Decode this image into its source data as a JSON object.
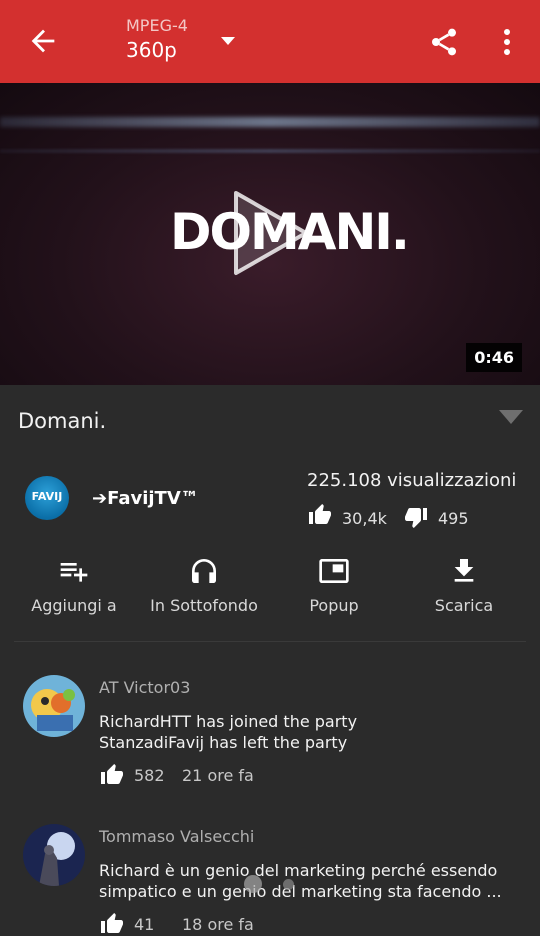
{
  "topbar": {
    "format": "MPEG-4",
    "resolution": "360p",
    "colors": {
      "bar": "#d3302f"
    }
  },
  "video": {
    "overlay_text": "DOMANI.",
    "duration": "0:46"
  },
  "details": {
    "title": "Domani.",
    "channel": "➔FavijTV™",
    "channel_avatar_text": "FAVIJ",
    "views": "225.108 visualizzazioni",
    "likes": "30,4k",
    "dislikes": "495"
  },
  "actions": [
    {
      "label": "Aggiungi a",
      "icon": "playlist-add-icon"
    },
    {
      "label": "In Sottofondo",
      "icon": "headphones-icon"
    },
    {
      "label": "Popup",
      "icon": "popup-icon"
    },
    {
      "label": "Scarica",
      "icon": "download-icon"
    }
  ],
  "comments": [
    {
      "author": "AT Victor03",
      "lines": [
        "RichardHTT has joined the party",
        "StanzadiFavij has left the party"
      ],
      "likes": "582",
      "time": "21 ore fa"
    },
    {
      "author": "Tommaso Valsecchi",
      "lines": [
        "Richard è un genio del marketing perché essendo",
        "simpatico e un genio del marketing sta facendo ..."
      ],
      "likes": "41",
      "time": "18 ore fa"
    }
  ]
}
